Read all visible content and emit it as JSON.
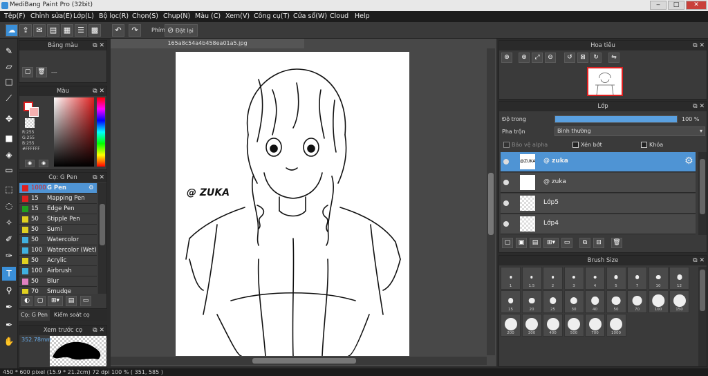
{
  "window": {
    "title": "MediBang Paint Pro (32bit)",
    "min": "‒",
    "max": "□",
    "close": "✕"
  },
  "menu": [
    "Tệp(F)",
    "Chỉnh sửa(E)",
    "Lớp(L)",
    "Bộ lọc(R)",
    "Chọn(S)",
    "Chụp(N)",
    "Màu (C)",
    "Xem(V)",
    "Công cụ(T)",
    "Cửa sổ(W)",
    "Cloud",
    "Help"
  ],
  "toolbar": {
    "phim_label": "Phím",
    "reset_label": "Đặt lại"
  },
  "doc_tab": "165a8c54a4b458ea01a5.jpg",
  "palette_panel": {
    "title": "Bảng màu",
    "empty_label": "---"
  },
  "color_panel": {
    "title": "Màu",
    "r": "R:255",
    "g": "G:255",
    "b": "B:255",
    "hex": "#FFFFFF"
  },
  "brush_panel": {
    "title": "Cọ: G Pen",
    "items": [
      {
        "size": "1000",
        "name": "G Pen",
        "color": "#e02020",
        "selected": true
      },
      {
        "size": "15",
        "name": "Mapping Pen",
        "color": "#e02020"
      },
      {
        "size": "15",
        "name": "Edge Pen",
        "color": "#20a020"
      },
      {
        "size": "50",
        "name": "Stipple Pen",
        "color": "#e0d020"
      },
      {
        "size": "50",
        "name": "Sumi",
        "color": "#e0d020"
      },
      {
        "size": "50",
        "name": "Watercolor",
        "color": "#40b0e0"
      },
      {
        "size": "100",
        "name": "Watercolor (Wet)",
        "color": "#40b0e0"
      },
      {
        "size": "50",
        "name": "Acrylic",
        "color": "#e0d020"
      },
      {
        "size": "100",
        "name": "Airbrush",
        "color": "#40b0e0"
      },
      {
        "size": "50",
        "name": "Blur",
        "color": "#e080c0"
      },
      {
        "size": "70",
        "name": "Smudge",
        "color": "#e0d020"
      }
    ]
  },
  "brush_tabs": {
    "tab1": "Cọ: G Pen",
    "tab2": "Kiểm soát cọ"
  },
  "preview_panel": {
    "title": "Xem trước cọ",
    "size_text": "352.78mm"
  },
  "navigator_panel": {
    "title": "Hoa tiêu"
  },
  "layer_panel": {
    "title": "Lớp",
    "opacity_label": "Độ trong",
    "opacity_value": "100 %",
    "opacity_fraction": 1.0,
    "blend_label": "Pha trộn",
    "blend_value": "Bình thường",
    "protect_alpha": "Bảo vệ alpha",
    "clipping": "Xén bớt",
    "lock": "Khóa",
    "layers": [
      {
        "name": "@ zuka",
        "thumb_text": "@ZUKA",
        "selected": true
      },
      {
        "name": "@ zuka",
        "thumb_text": "",
        "selected": false
      },
      {
        "name": "Lớp5",
        "thumb_text": "",
        "selected": false
      },
      {
        "name": "Lớp4",
        "thumb_text": "",
        "selected": false
      }
    ]
  },
  "brush_size_panel": {
    "title": "Brush Size",
    "sizes": [
      "1",
      "1.5",
      "2",
      "3",
      "4",
      "5",
      "7",
      "10",
      "12",
      "15",
      "20",
      "25",
      "30",
      "40",
      "50",
      "70",
      "100",
      "150",
      "200",
      "300",
      "400",
      "500",
      "700",
      "1000"
    ]
  },
  "canvas_text": "@ ZUKA",
  "status": {
    "text": "450 * 600 pixel   (15.9 * 21.2cm)   72 dpi   100 %   ( 351, 585 )"
  }
}
